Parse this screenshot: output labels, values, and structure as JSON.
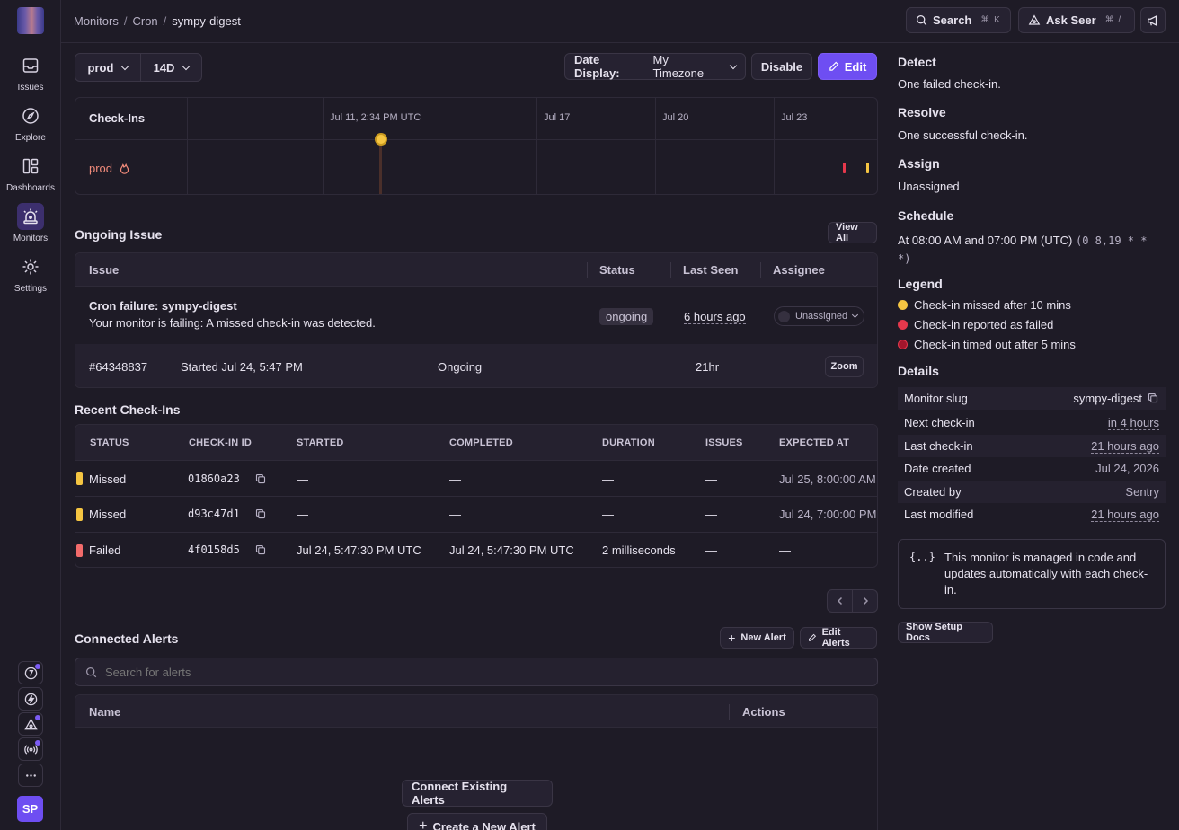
{
  "sidebar": {
    "items": [
      {
        "label": "Issues",
        "icon": "inbox-icon"
      },
      {
        "label": "Explore",
        "icon": "compass-icon"
      },
      {
        "label": "Dashboards",
        "icon": "dashboard-icon"
      },
      {
        "label": "Monitors",
        "icon": "siren-icon"
      },
      {
        "label": "Settings",
        "icon": "gear-icon"
      }
    ],
    "avatar": "SP"
  },
  "breadcrumbs": [
    "Monitors",
    "Cron",
    "sympy-digest"
  ],
  "topbar": {
    "search_label": "Search",
    "search_kbd": "⌘ K",
    "ask_label": "Ask Seer",
    "ask_kbd": "⌘ /"
  },
  "toolbar": {
    "env": "prod",
    "period": "14D",
    "date_display_label": "Date Display:",
    "date_display_value": "My Timezone",
    "disable_label": "Disable",
    "edit_label": "Edit"
  },
  "timeline": {
    "header": "Check-Ins",
    "ticks": [
      "Jul 11, 2:34 PM UTC",
      "Jul 17",
      "Jul 20",
      "Jul 23"
    ],
    "row_label": "prod"
  },
  "ongoing": {
    "title": "Ongoing Issue",
    "view_all": "View All",
    "headers": [
      "Issue",
      "Status",
      "Last Seen",
      "Assignee"
    ],
    "issue_title": "Cron failure: sympy-digest",
    "issue_desc": "Your monitor is failing: A missed check-in was detected.",
    "status": "ongoing",
    "last_seen": "6 hours ago",
    "assignee": "Unassigned",
    "incident_id": "#64348837",
    "incident_started": "Started Jul 24, 5:47 PM",
    "incident_state": "Ongoing",
    "incident_duration": "21hr",
    "zoom": "Zoom"
  },
  "recent": {
    "title": "Recent Check-Ins",
    "headers": [
      "STATUS",
      "CHECK-IN ID",
      "STARTED",
      "COMPLETED",
      "DURATION",
      "ISSUES",
      "EXPECTED AT"
    ],
    "rows": [
      {
        "status": "Missed",
        "color": "#f5c542",
        "id": "01860a23",
        "started": "—",
        "completed": "—",
        "duration": "—",
        "issues": "—",
        "expected": "Jul 25, 8:00:00 AM"
      },
      {
        "status": "Missed",
        "color": "#f5c542",
        "id": "d93c47d1",
        "started": "—",
        "completed": "—",
        "duration": "—",
        "issues": "—",
        "expected": "Jul 24, 7:00:00 PM"
      },
      {
        "status": "Failed",
        "color": "#f26b6b",
        "id": "4f0158d5",
        "started": "Jul 24, 5:47:30 PM UTC",
        "completed": "Jul 24, 5:47:30 PM UTC",
        "duration": "2 milliseconds",
        "issues": "—",
        "expected": "—"
      }
    ]
  },
  "alerts": {
    "title": "Connected Alerts",
    "new_alert": "New Alert",
    "edit_alerts": "Edit Alerts",
    "search_placeholder": "Search for alerts",
    "headers": [
      "Name",
      "Actions"
    ],
    "connect_existing": "Connect Existing Alerts",
    "create_new": "Create a New Alert"
  },
  "details": {
    "detect_h": "Detect",
    "detect_t": "One failed check-in.",
    "resolve_h": "Resolve",
    "resolve_t": "One successful check-in.",
    "assign_h": "Assign",
    "assign_t": "Unassigned",
    "schedule_h": "Schedule",
    "schedule_t": "At 08:00 AM and 07:00 PM (UTC)",
    "schedule_cron_a": "(0 8,19 * *",
    "schedule_cron_b": "*)",
    "legend_h": "Legend",
    "legend": [
      {
        "label": "Check-in missed after 10 mins",
        "color": "#f5c542"
      },
      {
        "label": "Check-in reported as failed",
        "color": "#e5384c"
      },
      {
        "label": "Check-in timed out after 5 mins",
        "color": "#a3162c"
      }
    ],
    "details_h": "Details",
    "kv": [
      {
        "k": "Monitor slug",
        "v": "sympy-digest"
      },
      {
        "k": "Next check-in",
        "v": "in 4 hours"
      },
      {
        "k": "Last check-in",
        "v": "21 hours ago"
      },
      {
        "k": "Date created",
        "v": "Jul 24, 2026"
      },
      {
        "k": "Created by",
        "v": "Sentry"
      },
      {
        "k": "Last modified",
        "v": "21 hours ago"
      }
    ],
    "managed_note": "This monitor is managed in code and updates automatically with each check-in.",
    "show_docs": "Show Setup Docs"
  },
  "colors": {
    "accent": "#6e4ef2",
    "missed": "#f5c542",
    "failed": "#e5384c",
    "timeout": "#a3162c"
  }
}
